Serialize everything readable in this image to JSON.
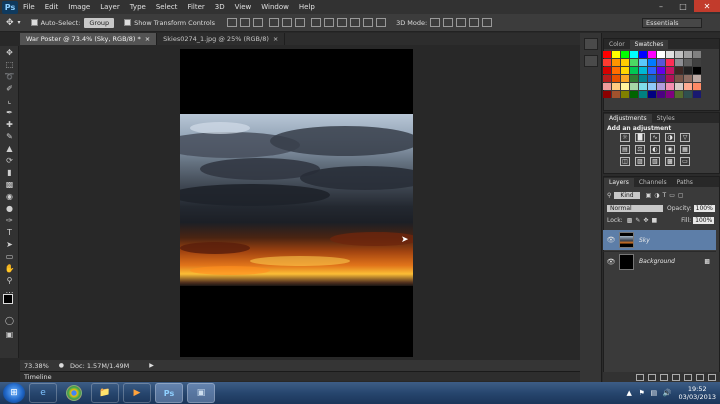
{
  "app": {
    "logo": "Ps"
  },
  "menubar": {
    "items": [
      "File",
      "Edit",
      "Image",
      "Layer",
      "Type",
      "Select",
      "Filter",
      "3D",
      "View",
      "Window",
      "Help"
    ]
  },
  "options": {
    "auto_select_label": "Auto-Select:",
    "auto_select_value": "Group",
    "show_transform": "Show Transform Controls",
    "mode_3d": "3D Mode:",
    "workspace": "Essentials"
  },
  "tabs": [
    {
      "label": "War Poster @ 73.4% (Sky, RGB/8) *",
      "close": "×"
    },
    {
      "label": "Skies0274_1.jpg @ 25% (RGB/8)",
      "close": "×"
    }
  ],
  "status": {
    "zoom": "73.38%",
    "doc": "Doc: 1.57M/1.49M"
  },
  "timeline": {
    "label": "Timeline"
  },
  "panels": {
    "color_tab": "Color",
    "swatches_tab": "Swatches",
    "adjustments_tab": "Adjustments",
    "styles_tab": "Styles",
    "add_adjustment": "Add an adjustment",
    "layers_tab": "Layers",
    "channels_tab": "Channels",
    "paths_tab": "Paths",
    "kind": "Kind",
    "blend_mode": "Normal",
    "opacity_label": "Opacity:",
    "opacity_value": "100%",
    "lock_label": "Lock:",
    "fill_label": "Fill:",
    "fill_value": "100%"
  },
  "layers": [
    {
      "name": "Sky",
      "selected": true
    },
    {
      "name": "Background",
      "selected": false
    }
  ],
  "taskbar": {
    "clock_time": "19:52",
    "clock_date": "03/03/2013"
  },
  "colors": {
    "selection": "#5d7ea8",
    "taskbar": "#27466e"
  },
  "swatches": [
    "#ff0000",
    "#ffff00",
    "#00ff00",
    "#00ffff",
    "#0000ff",
    "#ff00ff",
    "#ffffff",
    "#e0e0e0",
    "#c0c0c0",
    "#a0a0a0",
    "#808080",
    "#ff3b30",
    "#ff9500",
    "#ffcc00",
    "#4cd964",
    "#5ac8fa",
    "#007aff",
    "#5856d6",
    "#ff2d55",
    "#8e8e93",
    "#606060",
    "#404040",
    "#d50000",
    "#ff6d00",
    "#ffd600",
    "#00c853",
    "#00b8d4",
    "#2962ff",
    "#6200ea",
    "#c51162",
    "#3e2723",
    "#212121",
    "#000000",
    "#b71c1c",
    "#e65100",
    "#f9a825",
    "#2e7d32",
    "#00838f",
    "#1565c0",
    "#4527a0",
    "#ad1457",
    "#795548",
    "#8d6e63",
    "#bcaaa4",
    "#ef9a9a",
    "#ffcc80",
    "#fff59d",
    "#a5d6a7",
    "#80deea",
    "#90caf9",
    "#b39ddb",
    "#f48fb1",
    "#d7ccc8",
    "#ffab91",
    "#ff8a65",
    "#8b0000",
    "#a0522d",
    "#808000",
    "#006400",
    "#008080",
    "#000080",
    "#4b0082",
    "#800080",
    "#556b2f",
    "#2f4f4f",
    "#191970"
  ]
}
